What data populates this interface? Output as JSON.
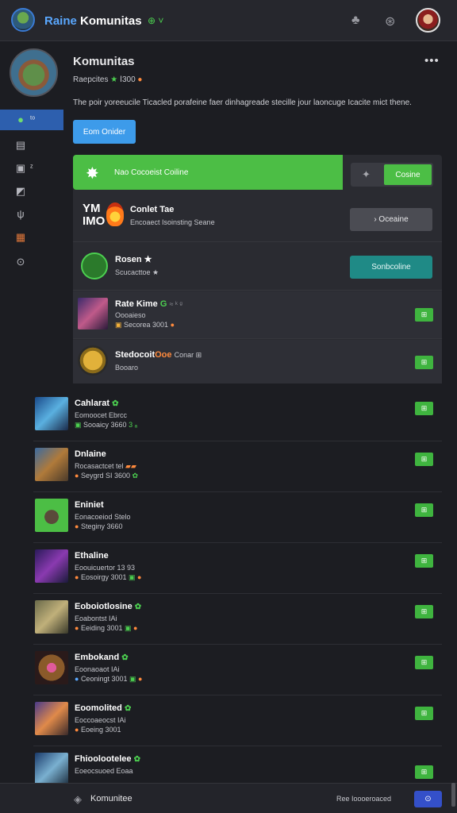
{
  "topbar": {
    "brand_part1": "Raine",
    "brand_part2": " Komunitas",
    "badge": "⊕ ˅",
    "icons": [
      "puzzle-icon",
      "settings-icon"
    ],
    "icon_glyphs": [
      "♣",
      "⊛"
    ]
  },
  "profile": {
    "title": "Komunitas",
    "stats_text": "Raepcites",
    "stats_star": "★",
    "stats_num": "Ⅰ300",
    "stats_emoji": "●",
    "description": "The poir yoreeucile Ticacled porafeine faer dinhagreade stecille jour laoncuge Icacite mict thene.",
    "primary_button": "Eom Onider",
    "more": "•••"
  },
  "sidebar": {
    "items": [
      {
        "icon": "chat-icon",
        "glyph": "●",
        "label": "ᵗᵒ"
      },
      {
        "icon": "image-icon",
        "glyph": "▤",
        "label": ""
      },
      {
        "icon": "media-icon",
        "glyph": "▣",
        "label": "ᶻ"
      },
      {
        "icon": "folder-icon",
        "glyph": "◩",
        "label": ""
      },
      {
        "icon": "shield-icon",
        "glyph": "ψ",
        "label": ""
      },
      {
        "icon": "game-icon",
        "glyph": "▦",
        "label": ""
      },
      {
        "icon": "help-icon",
        "glyph": "⊙",
        "label": ""
      }
    ]
  },
  "panel": {
    "banner_text": "Nao Cocoeist Coiline",
    "banner_button": "Cosine",
    "featured": [
      {
        "logo": "YM IMO",
        "title": "Conlet Tae",
        "sub": "Encoaect Isoinsting Seane",
        "button": "› Oceaine"
      },
      {
        "logo": "",
        "title": "Rosen ★",
        "sub": "Scucacttoe ★",
        "button": "Sonbcoline"
      }
    ],
    "list": [
      {
        "title": "Rate Kime",
        "badge": "G",
        "extra": "≈ ᵏ ᵍ",
        "sub1": "Oooaieso",
        "sub2": "Secorea 3001",
        "button": "⊞"
      },
      {
        "title": "Stedocoit",
        "badge": "Ooe",
        "extra": "Conar ⊞",
        "sub1": "Booaro",
        "sub2": "",
        "button": "⊞"
      }
    ]
  },
  "rows": [
    {
      "title": "Cahlarat",
      "star": "✿",
      "sub1": "Eomoocet Ebrcc",
      "sub2": "Sooaicy 3660",
      "tail": "3 ₐ"
    },
    {
      "title": "Dnlaine",
      "star": "",
      "sub1": "Rocasactcet tel",
      "sub2": "Seygrd SI 3600",
      "tail": "✿"
    },
    {
      "title": "Eniniet",
      "star": "",
      "sub1": "Eonacoeiod Stelo",
      "sub2": "Steginy 3660",
      "tail": ""
    },
    {
      "title": "Ethaline",
      "star": "",
      "sub1": "Eoouicuertor 13 93",
      "sub2": "Eosoirgy 3001",
      "tail": "●"
    },
    {
      "title": "Eoboiotlosine",
      "star": "✿",
      "sub1": "Eoabontst IAi",
      "sub2": "Eeiding 3001",
      "tail": "●"
    },
    {
      "title": "Embokand",
      "star": "✿",
      "sub1": "Eoonaoaot IAi",
      "sub2": "Ceoningt 3001",
      "tail": "●"
    },
    {
      "title": "Eoomolited",
      "star": "✿",
      "sub1": "Eoccoaeocst IAi",
      "sub2": "Eoeing 3001",
      "tail": ""
    },
    {
      "title": "Fhioolootelee",
      "star": "✿",
      "sub1": "Eoeocsuoed Eoaa",
      "sub2": "",
      "tail": ""
    }
  ],
  "bottombar": {
    "label": "Komunitee",
    "status": "Ree Ioooeroaced",
    "button": "⊙"
  }
}
